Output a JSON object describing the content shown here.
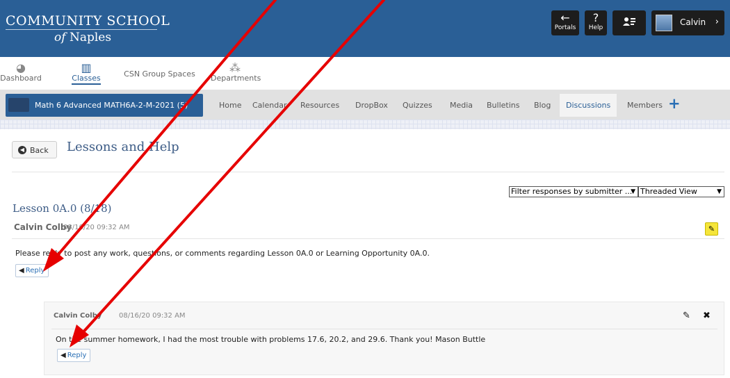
{
  "header": {
    "logo_line1": "COMMUNITY SCHOOL",
    "logo_line2_of": "of",
    "logo_line2": "Naples",
    "portals_label": "Portals",
    "help_label": "Help",
    "user_name": "Calvin"
  },
  "tabs": {
    "dashboard": "Dashboard",
    "classes": "Classes",
    "csn": "CSN Group Spaces",
    "departments": "Departments"
  },
  "classbar": {
    "class_name": "Math 6 Advanced MATH6A-2-M-2021 (5)",
    "nav": [
      "Home",
      "Calendar",
      "Resources",
      "DropBox",
      "Quizzes",
      "Media",
      "Bulletins",
      "Blog",
      "Discussions",
      "Members"
    ],
    "active": "Discussions"
  },
  "main": {
    "back_label": "Back",
    "page_title": "Lessons and Help",
    "filter_select": "Filter responses by submitter ...",
    "view_select": "Threaded View",
    "lesson_title": "Lesson 0A.0 (8/18)",
    "post": {
      "author": "Calvin Colby",
      "date": "08/16/20 09:32 AM",
      "text": "Please reply to post any work, questions, or comments regarding Lesson 0A.0 or Learning Opportunity 0A.0.",
      "reply_label": "Reply"
    },
    "reply": {
      "author": "Calvin Colby",
      "date": "08/16/20 09:32 AM",
      "text": "On the summer homework, I had the most trouble with problems 17.6, 20.2, and 29.6. Thank you! Mason Buttle",
      "reply_label": "Reply"
    }
  },
  "colors": {
    "header_bg": "#2a5f96",
    "annotation_arrow": "#e60000"
  },
  "icons": [
    "arrow-left-icon",
    "help-icon",
    "contact-card-icon",
    "chevron-right-icon",
    "dashboard-icon",
    "classes-icon",
    "departments-icon",
    "class-group-icon",
    "plus-icon",
    "back-circle-icon",
    "pencil-icon",
    "trash-icon",
    "reply-arrow-icon",
    "close-icon"
  ]
}
